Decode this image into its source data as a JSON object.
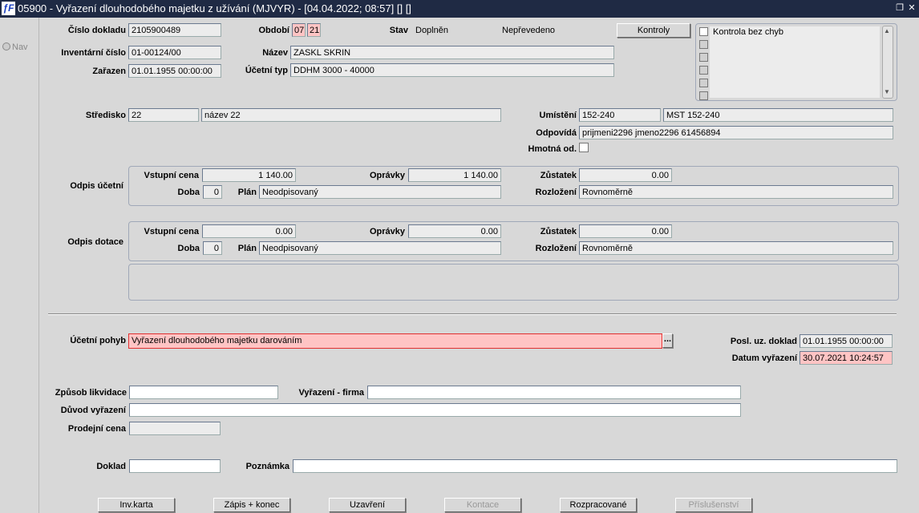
{
  "title": {
    "text": "05900 - Vyřazení dlouhodobého majetku z užívání (MJVYR) - [04.04.2022; 08:57]  [] []",
    "logo": "IF"
  },
  "sidebar": {
    "nav": "Nav"
  },
  "header": {
    "cislo_dokladu": {
      "label": "Číslo dokladu",
      "value": "2105900489"
    },
    "obdobi": {
      "label": "Období",
      "month": "07",
      "year": "21"
    },
    "stav": {
      "label": "Stav",
      "value": "Doplněn",
      "value2": "Nepřevedeno"
    },
    "kontroly_button": "Kontroly",
    "inventarni_cislo": {
      "label": "Inventární číslo",
      "value": "01-00124/00"
    },
    "nazev": {
      "label": "Název",
      "value": "ZASKL SKRIN"
    },
    "zarazen": {
      "label": "Zařazen",
      "value": "01.01.1955 00:00:00"
    },
    "ucetni_typ": {
      "label": "Účetní typ",
      "value": "DDHM 3000 - 40000"
    },
    "checks": [
      {
        "label": "Kontrola bez chyb",
        "checked": false
      }
    ]
  },
  "stredisko": {
    "label": "Středisko",
    "code": "22",
    "name": "název 22"
  },
  "umisteni": {
    "label": "Umístění",
    "code": "152-240",
    "name": "MST 152-240"
  },
  "odpovida": {
    "label": "Odpovídá",
    "value": "prijmeni2296 jmeno2296 61456894"
  },
  "hmotna_od": {
    "label": "Hmotná od.",
    "checked": false
  },
  "odpis_ucetni": {
    "label": "Odpis účetní",
    "vstupni_cena_label": "Vstupní cena",
    "vstupni_cena": "1 140.00",
    "opravky_label": "Oprávky",
    "opravky": "1 140.00",
    "zustatek_label": "Zůstatek",
    "zustatek": "0.00",
    "doba_label": "Doba",
    "doba": "0",
    "plan_label": "Plán",
    "plan": "Neodpisovaný",
    "rozlozeni_label": "Rozložení",
    "rozlozeni": "Rovnoměrně"
  },
  "odpis_dotace": {
    "label": "Odpis dotace",
    "vstupni_cena_label": "Vstupní cena",
    "vstupni_cena": "0.00",
    "opravky_label": "Oprávky",
    "opravky": "0.00",
    "zustatek_label": "Zůstatek",
    "zustatek": "0.00",
    "doba_label": "Doba",
    "doba": "0",
    "plan_label": "Plán",
    "plan": "Neodpisovaný",
    "rozlozeni_label": "Rozložení",
    "rozlozeni": "Rovnoměrně"
  },
  "ucetni_pohyb": {
    "label": "Účetní pohyb",
    "value": "Vyřazení dlouhodobého majetku darováním",
    "lov": "..."
  },
  "posl_uz_doklad": {
    "label": "Posl. uz. doklad",
    "value": "01.01.1955 00:00:00"
  },
  "datum_vyrazeni": {
    "label": "Datum vyřazení",
    "value": "30.07.2021 10:24:57"
  },
  "zpusob_likvidace": {
    "label": "Způsob likvidace",
    "value": ""
  },
  "vyrazeni_firma": {
    "label": "Vyřazení - firma",
    "value": ""
  },
  "duvod_vyrazeni": {
    "label": "Důvod vyřazení",
    "value": ""
  },
  "prodejni_cena": {
    "label": "Prodejní cena",
    "value": ""
  },
  "doklad": {
    "label": "Doklad",
    "value": ""
  },
  "poznamka": {
    "label": "Poznámka",
    "value": ""
  },
  "buttons": [
    {
      "label": "Inv.karta",
      "enabled": true
    },
    {
      "label": "Zápis + konec",
      "enabled": true
    },
    {
      "label": "Uzavření",
      "enabled": true
    },
    {
      "label": "Kontace",
      "enabled": false
    },
    {
      "label": "Rozpracované",
      "enabled": true
    },
    {
      "label": "Příslušenství",
      "enabled": false
    }
  ]
}
